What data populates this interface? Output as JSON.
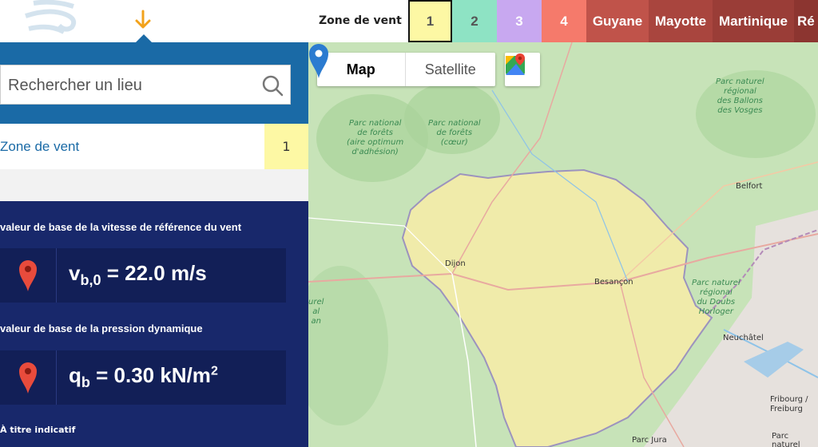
{
  "legend": {
    "title": "Zone de vent",
    "zones": [
      "1",
      "2",
      "3",
      "4",
      "Guyane",
      "Mayotte",
      "Martinique",
      "Ré"
    ]
  },
  "search": {
    "placeholder": "Rechercher un lieu"
  },
  "result": {
    "zone_label": "Zone de vent",
    "zone_value": "1",
    "speed_title": "valeur de base de la vitesse de référence du vent",
    "speed_symbol": "v",
    "speed_sub": "b,0",
    "speed_value": " = 22.0 m/s",
    "pressure_title": "valeur de base de la pression dynamique",
    "pressure_symbol": "q",
    "pressure_sub": "b",
    "pressure_value": " = 0.30 kN/m",
    "pressure_sup": "2",
    "footnote": "À titre indicatif"
  },
  "map": {
    "btn_map": "Map",
    "btn_satellite": "Satellite",
    "labels": {
      "dijon": "Dijon",
      "besancon": "Besançon",
      "belfort": "Belfort",
      "neuchatel": "Neuchâtel",
      "fribourg": "Fribourg /\nFreiburg",
      "park_foret1": "Parc national\nde forêts\n(aire optimum\nd'adhésion)",
      "park_foret2": "Parc national\nde forêts\n(cœur)",
      "park_vosges": "Parc naturel\nrégional\ndes Ballons\ndes Vosges",
      "park_doubs": "Parc naturel\nrégional\ndu Doubs\nHorloger",
      "park_left": "urel\nal\nan",
      "parc_jura": "Parc Jura",
      "parc_bottom": "Parc naturel"
    },
    "colors": {
      "region_fill": "#f3ecaa",
      "region_border": "#9a8fbf",
      "marker": "#2b7bd0"
    }
  }
}
